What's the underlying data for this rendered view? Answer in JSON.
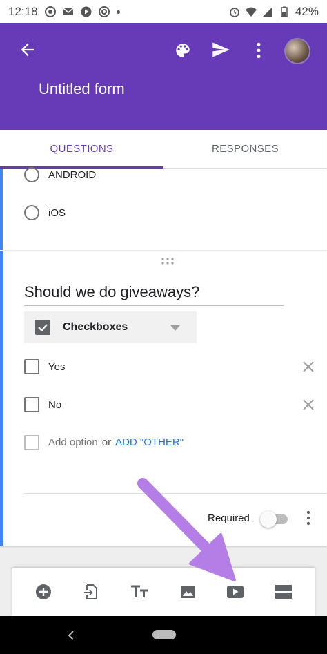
{
  "status_bar": {
    "time": "12:18",
    "battery": "42%",
    "icons_left": [
      "whatsapp-icon",
      "mail-icon",
      "play-icon",
      "aperture-icon",
      "dot-icon"
    ],
    "icons_right": [
      "alarm-icon",
      "wifi-icon",
      "signal-icon",
      "battery-icon"
    ]
  },
  "app_bar": {
    "title": "Untitled form",
    "color": "#673ab7",
    "actions": [
      "palette-icon",
      "send-icon",
      "more-vert-icon"
    ]
  },
  "tabs": [
    {
      "label": "QUESTIONS",
      "active": true
    },
    {
      "label": "RESPONSES",
      "active": false
    }
  ],
  "previous_card": {
    "options": [
      "ANDROID",
      "iOS"
    ]
  },
  "question_card": {
    "question": "Should we do giveaways?",
    "type": "Checkboxes",
    "options": [
      "Yes",
      "No"
    ],
    "add_option": "Add option",
    "or": "or",
    "add_other": "ADD \"OTHER\"",
    "required_label": "Required",
    "required": false
  },
  "toolbar": {
    "buttons": [
      "add-question-icon",
      "import-questions-icon",
      "add-title-icon",
      "add-image-icon",
      "add-video-icon",
      "add-section-icon"
    ]
  },
  "accent_colors": {
    "primary": "#673ab7",
    "card_indicator": "#4285f4",
    "link": "#1a73e8",
    "annotation_arrow": "#b57ee6"
  }
}
